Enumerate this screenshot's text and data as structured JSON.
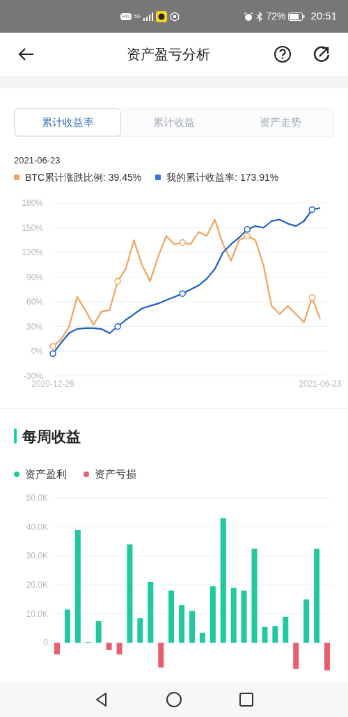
{
  "status_bar": {
    "badges": [
      "HD",
      "5G"
    ],
    "battery": "72%",
    "time": "20:51"
  },
  "header": {
    "title": "资产盈亏分析"
  },
  "tabs": [
    {
      "label": "累计收益率",
      "selected": true
    },
    {
      "label": "累计收益",
      "selected": false
    },
    {
      "label": "资产走势",
      "selected": false
    }
  ],
  "readout": {
    "date": "2021-06-23",
    "items": [
      {
        "label": "BTC累计涨跌比例: 39.45%",
        "color": "#f0a35e"
      },
      {
        "label": "我的累计收益率: 173.91%",
        "color": "#2f7be0"
      }
    ]
  },
  "return_chart": {
    "chart_data": {
      "type": "line",
      "grid": true,
      "categories": [
        "2020-12-26",
        null,
        null,
        null,
        null,
        null,
        null,
        null,
        null,
        null,
        null,
        null,
        null,
        null,
        null,
        null,
        null,
        null,
        null,
        null,
        null,
        null,
        null,
        null,
        null,
        null,
        null,
        null,
        null,
        null,
        null,
        null,
        null,
        "2021-06-23"
      ],
      "ylim": [
        -30,
        180
      ],
      "yticks": [
        {
          "value": -30,
          "label": "-30%"
        },
        {
          "value": 0,
          "label": "0%"
        },
        {
          "value": 30,
          "label": "30%"
        },
        {
          "value": 60,
          "label": "60%"
        },
        {
          "value": 90,
          "label": "90%"
        },
        {
          "value": 120,
          "label": "120%"
        },
        {
          "value": 150,
          "label": "150%"
        },
        {
          "value": 180,
          "label": "180%"
        }
      ],
      "series": [
        {
          "color": "#f0a35e",
          "values": [
            6,
            14,
            30,
            66,
            50,
            32,
            48,
            50,
            85,
            100,
            135,
            105,
            85,
            115,
            140,
            130,
            132,
            130,
            145,
            140,
            160,
            130,
            110,
            135,
            140,
            135,
            105,
            55,
            45,
            55,
            45,
            35,
            65,
            39
          ]
        },
        {
          "color": "#1f5fc4",
          "values": [
            -3,
            10,
            22,
            27,
            28,
            28,
            27,
            22,
            30,
            38,
            45,
            52,
            55,
            58,
            62,
            66,
            70,
            75,
            80,
            88,
            100,
            120,
            130,
            138,
            148,
            152,
            150,
            158,
            160,
            155,
            152,
            158,
            172,
            174
          ]
        }
      ]
    }
  },
  "weekly": {
    "title": "每周收益",
    "chart_data": {
      "type": "bar",
      "stacked": true,
      "grid": true,
      "ylim": [
        -10000,
        50000
      ],
      "yticks": [
        {
          "value": 0,
          "label": "0"
        },
        {
          "value": 10000,
          "label": "10.0K"
        },
        {
          "value": 20000,
          "label": "20.0K"
        },
        {
          "value": 30000,
          "label": "30.0K"
        },
        {
          "value": 40000,
          "label": "40.0K"
        },
        {
          "value": 50000,
          "label": "50.0K"
        }
      ],
      "series": [
        {
          "name": "资产盈利",
          "color": "#22c9a0",
          "values": [
            null,
            11500,
            39000,
            300,
            7500,
            null,
            null,
            34000,
            8500,
            21000,
            null,
            18000,
            13000,
            11000,
            3500,
            19500,
            43000,
            19000,
            18000,
            32500,
            5500,
            5800,
            9000,
            null,
            15000,
            32500,
            null
          ]
        },
        {
          "name": "资产亏损",
          "color": "#e85d6f",
          "values": [
            -4000,
            null,
            null,
            null,
            null,
            -2500,
            -4000,
            null,
            null,
            null,
            -8500,
            null,
            null,
            null,
            null,
            null,
            null,
            null,
            null,
            null,
            null,
            null,
            null,
            -9000,
            null,
            null,
            -9500
          ]
        }
      ]
    }
  }
}
